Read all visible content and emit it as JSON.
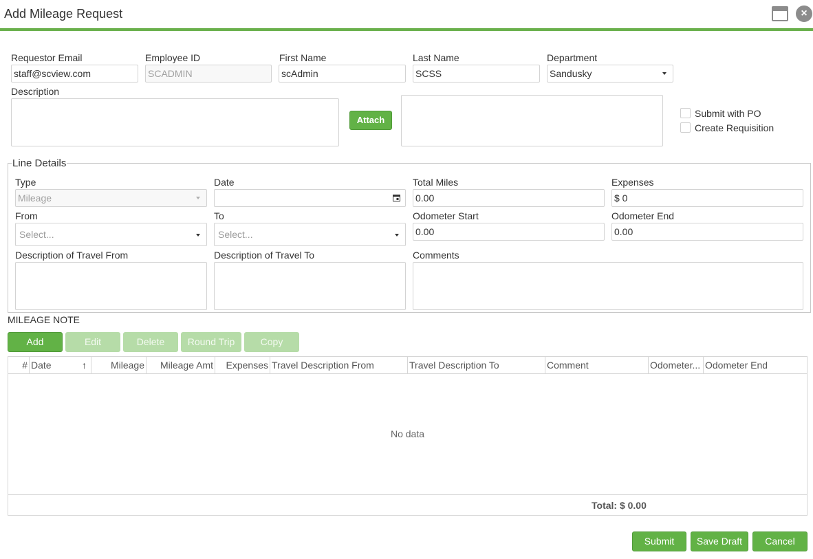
{
  "window": {
    "title": "Add Mileage Request"
  },
  "header_fields": {
    "requestor_email": {
      "label": "Requestor Email",
      "value": "staff@scview.com"
    },
    "employee_id": {
      "label": "Employee ID",
      "value": "SCADMIN"
    },
    "first_name": {
      "label": "First Name",
      "value": "scAdmin"
    },
    "last_name": {
      "label": "Last Name",
      "value": "SCSS"
    },
    "department": {
      "label": "Department",
      "value": "Sandusky"
    },
    "description": {
      "label": "Description",
      "value": ""
    }
  },
  "attach_button": "Attach",
  "options": {
    "submit_with_po": "Submit with PO",
    "create_requisition": "Create Requisition"
  },
  "line_details": {
    "legend": "Line Details",
    "type": {
      "label": "Type",
      "value": "Mileage"
    },
    "date": {
      "label": "Date",
      "value": ""
    },
    "total_miles": {
      "label": "Total Miles",
      "value": "0.00"
    },
    "expenses": {
      "label": "Expenses",
      "value": "$ 0"
    },
    "from": {
      "label": "From",
      "placeholder": "Select..."
    },
    "to": {
      "label": "To",
      "placeholder": "Select..."
    },
    "odometer_start": {
      "label": "Odometer Start",
      "value": "0.00"
    },
    "odometer_end": {
      "label": "Odometer End",
      "value": "0.00"
    },
    "desc_from": {
      "label": "Description of Travel From"
    },
    "desc_to": {
      "label": "Description of Travel To"
    },
    "comments": {
      "label": "Comments"
    }
  },
  "mileage_note": "MILEAGE NOTE",
  "toolbar": {
    "add": "Add",
    "edit": "Edit",
    "delete": "Delete",
    "round_trip": "Round Trip",
    "copy": "Copy"
  },
  "grid": {
    "columns": [
      "#",
      "Date",
      "Mileage",
      "Mileage Amt",
      "Expenses",
      "Travel Description From",
      "Travel Description To",
      "Comment",
      "Odometer...",
      "Odometer End"
    ],
    "sort_indicator": "↑",
    "empty_text": "No data",
    "total": "Total: $ 0.00"
  },
  "footer": {
    "submit": "Submit",
    "save_draft": "Save Draft",
    "cancel": "Cancel"
  },
  "colors": {
    "accent": "#62b246",
    "accent_disabled": "#b6dca8",
    "title_rule": "#6ab04c"
  },
  "icons": [
    "maximize-icon",
    "close-icon",
    "calendar-icon",
    "chevron-down-icon",
    "sort-asc-icon"
  ]
}
